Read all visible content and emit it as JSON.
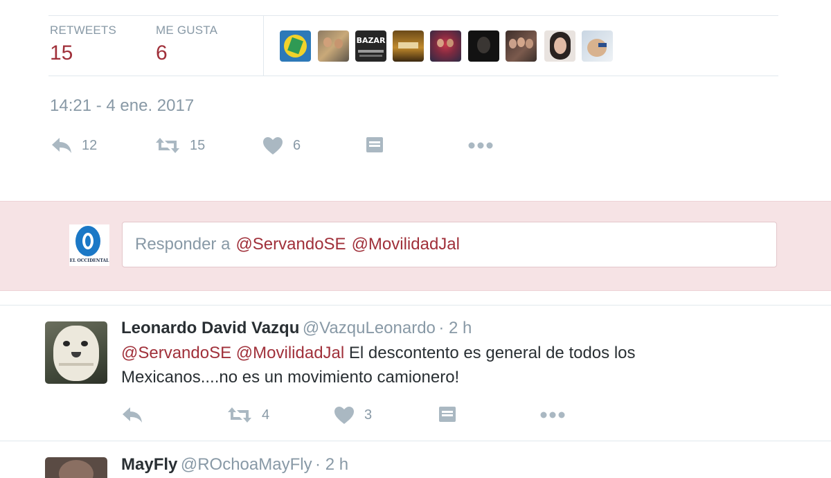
{
  "stats": {
    "retweets_label": "RETWEETS",
    "retweets_value": "15",
    "likes_label": "ME GUSTA",
    "likes_value": "6"
  },
  "liker_avatars": [
    "avatar-1",
    "avatar-2",
    "avatar-3",
    "avatar-4",
    "avatar-5",
    "avatar-6",
    "avatar-7",
    "avatar-8",
    "avatar-9"
  ],
  "liker_avatar_3_text": "BAZAR",
  "timestamp": "14:21 - 4 ene. 2017",
  "main_actions": {
    "reply_count": "12",
    "retweet_count": "15",
    "like_count": "6"
  },
  "reply": {
    "prefix": "Responder a",
    "mention_1": "@ServandoSE",
    "mention_2": "@MovilidadJal",
    "avatar_text": "EL OCCIDENTAL"
  },
  "tweet_1": {
    "name": "Leonardo David Vazqu",
    "handle": "@VazquLeonardo",
    "time": "· 2 h",
    "mention_1": "@ServandoSE",
    "mention_2": "@MovilidadJal",
    "text_line1": "El descontento es general de todos los",
    "text_line2": "Mexicanos....no es un movimiento camionero!",
    "retweet_count": "4",
    "like_count": "3"
  },
  "tweet_2": {
    "name": "MayFly",
    "handle": "@ROchoaMayFly",
    "time": "· 2 h"
  },
  "colors": {
    "accent": "#a0303a",
    "muted": "#8899a6",
    "reply_band": "#f6e3e5"
  }
}
